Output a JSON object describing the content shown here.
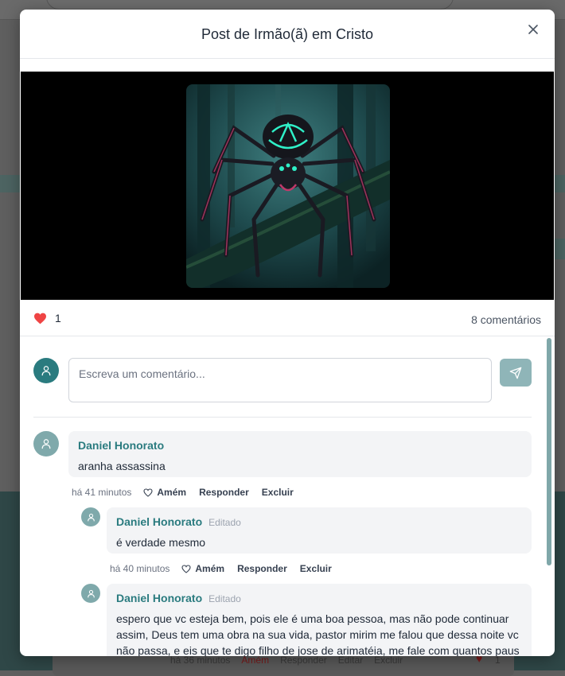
{
  "modal": {
    "title": "Post de Irmão(ã) em Cristo",
    "close_icon": "close-icon"
  },
  "post": {
    "image_description_icon": "spider-artwork",
    "likes": "1",
    "comments_label": "8 comentários"
  },
  "composer": {
    "placeholder": "Escreva um comentário...",
    "send_icon": "send-icon"
  },
  "comments": [
    {
      "author": "Daniel Honorato",
      "edited": "",
      "text": "aranha assassina",
      "time": "há 41 minutos",
      "amem": "Amém",
      "reply": "Responder",
      "delete": "Excluir"
    },
    {
      "author": "Daniel Honorato",
      "edited": "Editado",
      "text": "é verdade mesmo",
      "time": "há 40 minutos",
      "amem": "Amém",
      "reply": "Responder",
      "delete": "Excluir"
    },
    {
      "author": "Daniel Honorato",
      "edited": "Editado",
      "text": "espero que vc esteja bem, pois ele é uma boa pessoa, mas não pode continuar assim, Deus tem uma obra na sua vida, pastor mirim me falou que dessa noite vc não passa, e eis que te digo filho de jose de arimatéia, me fale com quantos paus se faz uma canoa que eu te digo quem és!",
      "time": "",
      "amem": "",
      "reply": "",
      "delete": ""
    }
  ],
  "background": {
    "time": "há 36 minutos",
    "amem": "Amém",
    "reply": "Responder",
    "edit": "Editar",
    "delete": "Excluir",
    "likes": "1"
  },
  "colors": {
    "accent": "#2a7b7f",
    "like": "#ef4444",
    "send_button": "#8fb5b8"
  }
}
